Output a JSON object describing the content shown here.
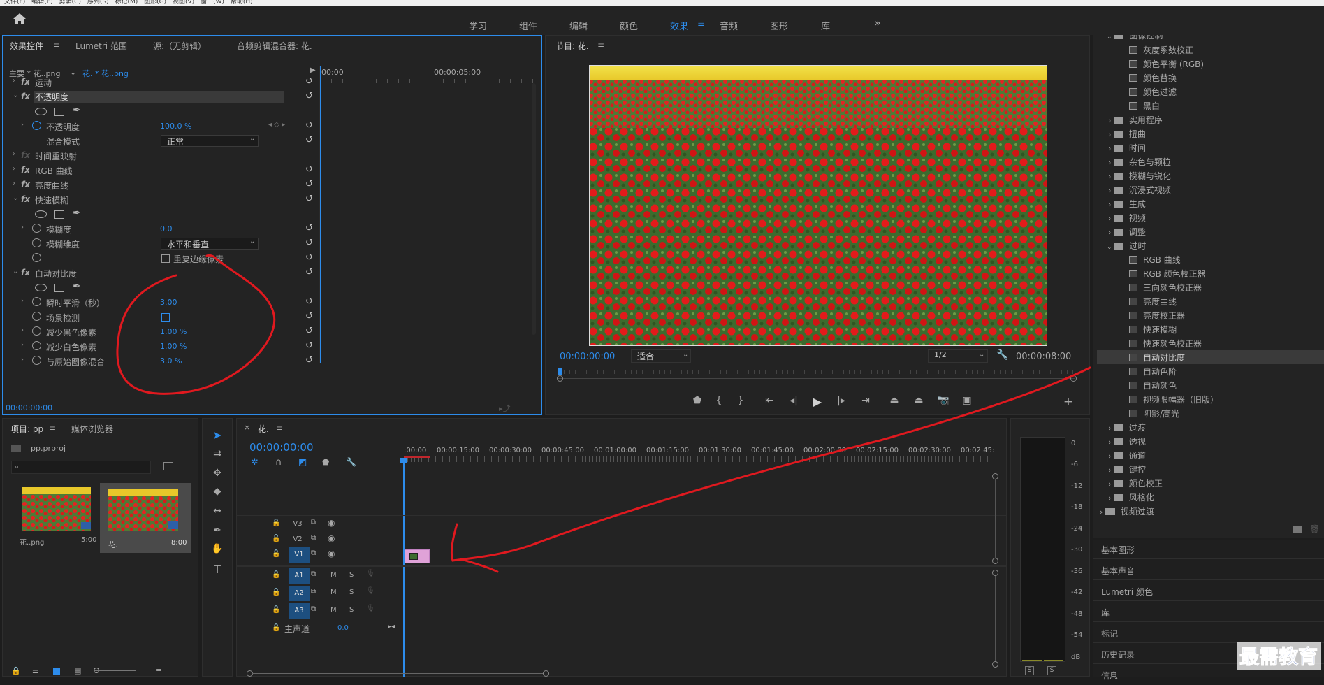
{
  "menubar": [
    "文件(F)",
    "编辑(E)",
    "剪辑(C)",
    "序列(S)",
    "标记(M)",
    "图形(G)",
    "视图(V)",
    "窗口(W)",
    "帮助(H)"
  ],
  "workspaces": [
    "学习",
    "组件",
    "编辑",
    "颜色",
    "效果",
    "音频",
    "图形",
    "库"
  ],
  "workspace_more": "»",
  "effect_controls": {
    "tabs": [
      "效果控件",
      "Lumetri 范围",
      "源:（无剪辑）",
      "音频剪辑混合器: 花."
    ],
    "master": "主要 * 花..png",
    "clip": "花. * 花..png",
    "ruler": [
      "00:00",
      "00:00:05:00"
    ],
    "rows": {
      "motion": "运动",
      "opacity": "不透明度",
      "opacity_prop": "不透明度",
      "opacity_val": "100.0 %",
      "blend": "混合模式",
      "blend_val": "正常",
      "time_remap": "时间重映射",
      "rgb_curves": "RGB 曲线",
      "lum_curves": "亮度曲线",
      "fast_blur": "快速模糊",
      "blurriness": "模糊度",
      "blurriness_val": "0.0",
      "blur_dim": "模糊维度",
      "blur_dim_val": "水平和垂直",
      "repeat_edge": "重复边缘像素",
      "auto_contrast": "自动对比度",
      "temporal": "瞬时平滑（秒）",
      "temporal_val": "3.00",
      "scene": "场景检测",
      "black_clip": "减少黑色像素",
      "black_clip_val": "1.00 %",
      "white_clip": "减少白色像素",
      "white_clip_val": "1.00 %",
      "blend_orig": "与原始图像混合",
      "blend_orig_val": "3.0 %"
    },
    "timecode": "00:00:00:00"
  },
  "program": {
    "title": "节目: 花.",
    "timecode": "00:00:00:00",
    "fit": "适合",
    "resolution": "1/2",
    "duration": "00:00:08:00"
  },
  "effects_tree": {
    "partial_top": "图像控制",
    "image_control": [
      "灰度系数校正",
      "颜色平衡 (RGB)",
      "颜色替换",
      "颜色过滤",
      "黑白"
    ],
    "folders_a": [
      "实用程序",
      "扭曲",
      "时间",
      "杂色与颗粒",
      "模糊与锐化",
      "沉浸式视频",
      "生成",
      "视频",
      "调整",
      "过时"
    ],
    "obsolete": [
      "RGB 曲线",
      "RGB 颜色校正器",
      "三向颜色校正器",
      "亮度曲线",
      "亮度校正器",
      "快速模糊",
      "快速颜色校正器",
      "自动对比度",
      "自动色阶",
      "自动颜色",
      "视频限幅器（旧版）",
      "阴影/高光"
    ],
    "folders_b": [
      "过渡",
      "透视",
      "通道",
      "键控",
      "颜色校正",
      "风格化"
    ],
    "video_transitions": "视频过渡"
  },
  "side_panels": [
    "基本图形",
    "基本声音",
    "Lumetri 颜色",
    "库",
    "标记",
    "历史记录",
    "信息"
  ],
  "project": {
    "tabs": [
      "项目: pp",
      "媒体浏览器"
    ],
    "file": "pp.prproj",
    "items": [
      {
        "name": "花..png",
        "dur": "5:00"
      },
      {
        "name": "花.",
        "dur": "8:00"
      }
    ]
  },
  "timeline": {
    "tab": "花.",
    "timecode": "00:00:00:00",
    "ruler": [
      ":00:00",
      "00:00:15:00",
      "00:00:30:00",
      "00:00:45:00",
      "00:01:00:00",
      "00:01:15:00",
      "00:01:30:00",
      "00:01:45:00",
      "00:02:00:00",
      "00:02:15:00",
      "00:02:30:00",
      "00:02:45:"
    ],
    "video_tracks": [
      "V3",
      "V2",
      "V1"
    ],
    "audio_tracks": [
      "A1",
      "A2",
      "A3"
    ],
    "master": "主声道",
    "master_val": "0.0",
    "m": "M",
    "s": "S"
  },
  "meter": {
    "scale": [
      "0",
      "-6",
      "-12",
      "-18",
      "-24",
      "-30",
      "-36",
      "-42",
      "-48",
      "-54",
      "dB"
    ],
    "s": "S"
  },
  "watermark": "最需教育",
  "colors": {
    "accent": "#2d8ceb",
    "annotation": "#e0191f",
    "bg": "#1d1d1d",
    "panel": "#232323"
  }
}
